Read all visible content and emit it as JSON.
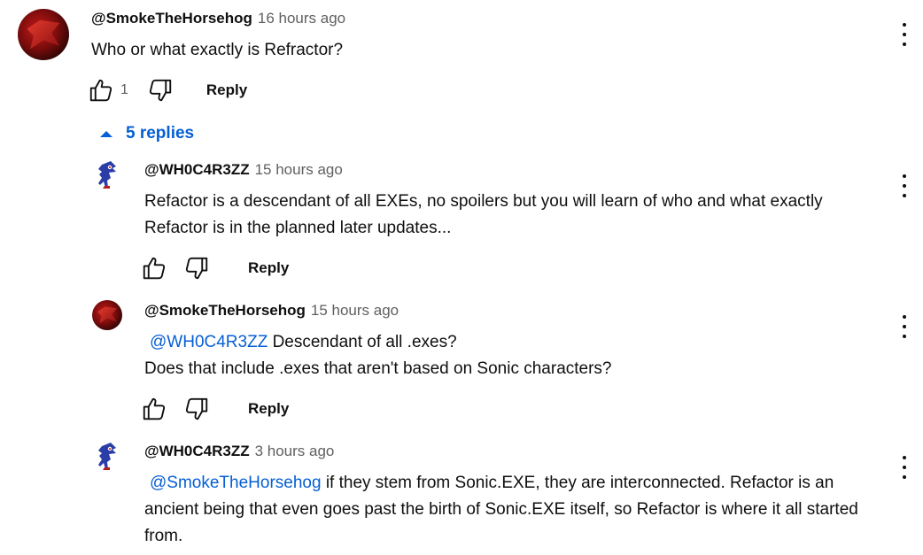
{
  "comments": [
    {
      "author": "@SmokeTheHorsehog",
      "time": "16 hours ago",
      "mention": "",
      "text": "Who or what exactly is Refractor?",
      "likes": "1",
      "reply_label": "Reply",
      "avatar_icon": "red-hedgehog-avatar"
    },
    {
      "author": "@WH0C4R3ZZ",
      "time": "15 hours ago",
      "mention": "",
      "text": "Refactor is a descendant of all EXEs, no spoilers but you will learn of who and what exactly Refactor is in the planned later updates...",
      "likes": "",
      "reply_label": "Reply",
      "avatar_icon": "sonic-sprite-avatar"
    },
    {
      "author": "@SmokeTheHorsehog",
      "time": "15 hours ago",
      "mention": "@WH0C4R3ZZ",
      "text": " Descendant of all .exes?\nDoes that include .exes that aren't based on Sonic characters?",
      "likes": "",
      "reply_label": "Reply",
      "avatar_icon": "red-hedgehog-avatar"
    },
    {
      "author": "@WH0C4R3ZZ",
      "time": "3 hours ago",
      "mention": "@SmokeTheHorsehog",
      "text": " if they stem from Sonic.EXE, they are interconnected. Refactor is an ancient being that even goes past the birth of Sonic.EXE itself, so Refactor is where it all started from.",
      "likes": "",
      "reply_label": "Reply",
      "avatar_icon": "sonic-sprite-avatar"
    }
  ],
  "replies_toggle": {
    "label": "5 replies",
    "icon": "caret-up-icon"
  },
  "colors": {
    "link": "#065fd4",
    "meta": "#606060",
    "text": "#0f0f0f"
  }
}
